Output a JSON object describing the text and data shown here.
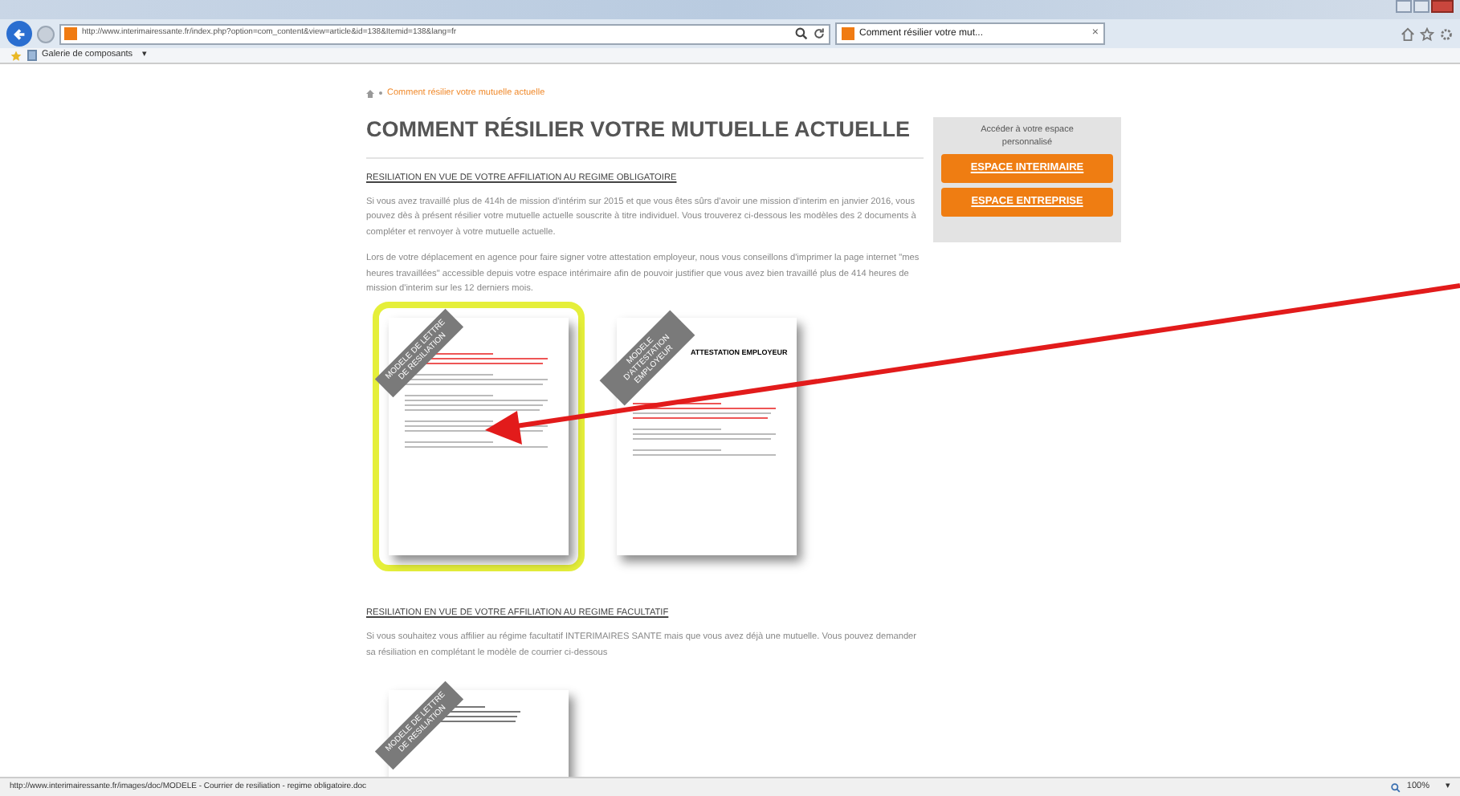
{
  "browser": {
    "address": "http://www.interimairessante.fr/index.php?option=com_content&view=article&id=138&Itemid=138&lang=fr",
    "tab": {
      "title": "Comment résilier votre mut...",
      "close": "×"
    },
    "favorites": [
      {
        "label": "Galerie de composants",
        "caret": "▾"
      }
    ]
  },
  "page": {
    "breadcrumb": "Comment résilier votre mutuelle actuelle",
    "title": "COMMENT RÉSILIER VOTRE MUTUELLE ACTUELLE",
    "sections": [
      {
        "heading": "RESILIATION EN VUE DE VOTRE AFFILIATION AU REGIME OBLIGATOIRE",
        "paragraphs": [
          "Si vous avez travaillé plus de 414h de mission d'intérim sur 2015 et que vous êtes sûrs d'avoir une mission d'interim en janvier 2016, vous pouvez dès à présent résilier votre mutuelle actuelle souscrite à titre individuel. Vous trouverez ci-dessous les modèles des 2 documents à compléter et renvoyer à votre mutuelle actuelle.",
          "Lors de votre déplacement en agence pour faire signer votre attestation employeur, nous vous conseillons d'imprimer la page internet \"mes heures travaillées\" accessible depuis votre espace intérimaire afin de pouvoir justifier que vous avez bien travaillé plus de 414 heures de mission d'interim sur les 12 derniers mois."
        ],
        "documents": [
          {
            "kind": "letter",
            "ribbon": "MODELE DE LETTRE DE RESILIATION",
            "highlighted": true
          },
          {
            "kind": "attestation",
            "ribbon": "MODELE D'ATTESTATION EMPLOYEUR",
            "heading": "ATTESTATION EMPLOYEUR",
            "highlighted": false
          }
        ]
      },
      {
        "heading": "RESILIATION EN VUE DE VOTRE AFFILIATION AU REGIME FACULTATIF",
        "paragraphs": [
          "Si vous souhaitez vous affilier au régime facultatif INTERIMAIRES SANTE mais que vous avez déjà une mutuelle. Vous pouvez demander sa résiliation en complétant le modèle de courrier ci-dessous"
        ],
        "documents": [
          {
            "kind": "form",
            "ribbon": "MODELE DE LETTRE DE RESILIATION",
            "highlighted": false
          }
        ]
      }
    ]
  },
  "sidebar": {
    "caption": "Accéder à votre espace personnalisé",
    "buttons": [
      "ESPACE INTERIMAIRE",
      "ESPACE ENTREPRISE"
    ]
  },
  "status_bar": {
    "url": "http://www.interimairessante.fr/images/doc/MODELE - Courrier de resiliation - regime obligatoire.doc",
    "zoom": "100%",
    "caret": "▾"
  }
}
